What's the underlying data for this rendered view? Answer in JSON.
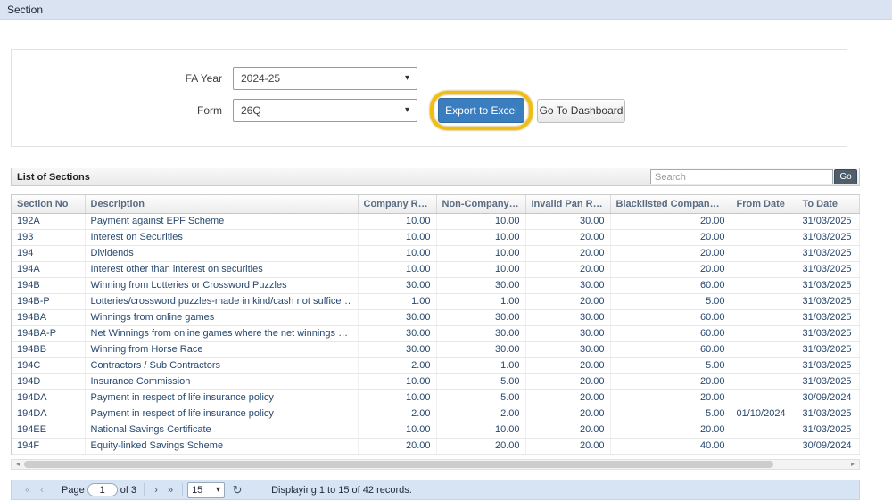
{
  "page": {
    "title": "Section"
  },
  "filters": {
    "fa_year_label": "FA Year",
    "fa_year_value": "2024-25",
    "form_label": "Form",
    "form_value": "26Q",
    "export_button_label": "Export to Excel",
    "dashboard_button_label": "Go To Dashboard"
  },
  "list_header": {
    "title": "List of Sections",
    "search_placeholder": "Search",
    "go_button_label": "Go"
  },
  "table": {
    "columns": [
      "Section No",
      "Description",
      "Company Rate",
      "Non-Company Rate",
      "Invalid Pan Rate",
      "Blacklisted Company Rate",
      "From Date",
      "To Date"
    ],
    "rows": [
      [
        "192A",
        "Payment against EPF Scheme",
        "10.00",
        "10.00",
        "30.00",
        "20.00",
        "",
        "31/03/2025"
      ],
      [
        "193",
        "Interest on Securities",
        "10.00",
        "10.00",
        "20.00",
        "20.00",
        "",
        "31/03/2025"
      ],
      [
        "194",
        "Dividends",
        "10.00",
        "10.00",
        "20.00",
        "20.00",
        "",
        "31/03/2025"
      ],
      [
        "194A",
        "Interest other than interest on securities",
        "10.00",
        "10.00",
        "20.00",
        "20.00",
        "",
        "31/03/2025"
      ],
      [
        "194B",
        "Winning from Lotteries or Crossword Puzzles",
        "30.00",
        "30.00",
        "30.00",
        "60.00",
        "",
        "31/03/2025"
      ],
      [
        "194B-P",
        "Lotteries/crossword puzzles-made in kind/cash not suffice to mee...",
        "1.00",
        "1.00",
        "20.00",
        "5.00",
        "",
        "31/03/2025"
      ],
      [
        "194BA",
        "Winnings from online games",
        "30.00",
        "30.00",
        "30.00",
        "60.00",
        "",
        "31/03/2025"
      ],
      [
        "194BA-P",
        "Net Winnings from online games where the net winnings are mad...",
        "30.00",
        "30.00",
        "30.00",
        "60.00",
        "",
        "31/03/2025"
      ],
      [
        "194BB",
        "Winning from Horse Race",
        "30.00",
        "30.00",
        "30.00",
        "60.00",
        "",
        "31/03/2025"
      ],
      [
        "194C",
        "Contractors / Sub Contractors",
        "2.00",
        "1.00",
        "20.00",
        "5.00",
        "",
        "31/03/2025"
      ],
      [
        "194D",
        "Insurance Commission",
        "10.00",
        "5.00",
        "20.00",
        "20.00",
        "",
        "31/03/2025"
      ],
      [
        "194DA",
        "Payment in respect of life insurance policy",
        "10.00",
        "5.00",
        "20.00",
        "20.00",
        "",
        "30/09/2024"
      ],
      [
        "194DA",
        "Payment in respect of life insurance policy",
        "2.00",
        "2.00",
        "20.00",
        "5.00",
        "01/10/2024",
        "31/03/2025"
      ],
      [
        "194EE",
        "National Savings Certificate",
        "10.00",
        "10.00",
        "20.00",
        "20.00",
        "",
        "31/03/2025"
      ],
      [
        "194F",
        "Equity-linked Savings Scheme",
        "20.00",
        "20.00",
        "20.00",
        "40.00",
        "",
        "30/09/2024"
      ]
    ]
  },
  "pager": {
    "page_label": "Page",
    "page_value": "1",
    "of_text": "of 3",
    "page_size_value": "15",
    "status": "Displaying 1 to 15 of 42 records."
  },
  "icons": {
    "select_chevron": "▾",
    "pager_first": "«",
    "pager_prev": "‹",
    "pager_next": "›",
    "pager_last": "»",
    "refresh": "↻",
    "scroll_left": "◂",
    "scroll_right": "▸"
  },
  "colors": {
    "accent_blue": "#3a7ebf",
    "highlight_yellow": "#eebf12",
    "topbar_bg": "#d9e3f1",
    "pager_bg": "#d6e4f3",
    "row_text": "#26486f"
  }
}
